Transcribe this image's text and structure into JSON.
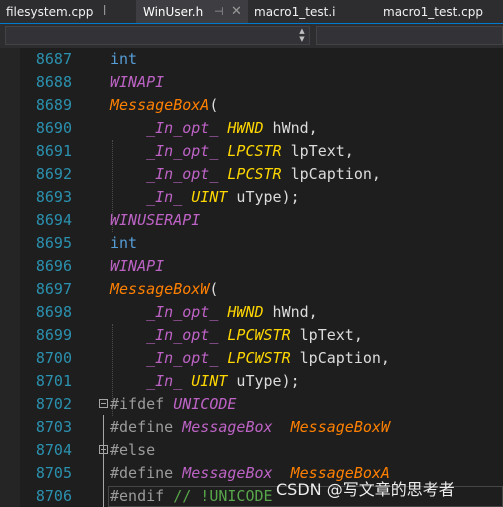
{
  "tabs": [
    {
      "label": "filesystem.cpp",
      "pin": "ꟾ"
    },
    {
      "label": "WinUser.h",
      "pin": "⊣",
      "close": "✕"
    },
    {
      "label": "macro1_test.i"
    },
    {
      "label": "macro1_test.cpp"
    }
  ],
  "nav": {
    "left_dropdown_value": "",
    "right_dropdown_value": ""
  },
  "lines": [
    {
      "n": "8687",
      "parts": [
        {
          "t": "int",
          "c": "kw"
        }
      ]
    },
    {
      "n": "8688",
      "parts": [
        {
          "t": "WINAPI",
          "c": "mac"
        }
      ]
    },
    {
      "n": "8689",
      "parts": [
        {
          "t": "MessageBoxA",
          "c": "fn"
        },
        {
          "t": "(",
          "c": ""
        }
      ]
    },
    {
      "n": "8690",
      "parts": [
        {
          "t": "    ",
          "c": ""
        },
        {
          "t": "_In_opt_",
          "c": "mac"
        },
        {
          "t": " ",
          "c": ""
        },
        {
          "t": "HWND",
          "c": "typ"
        },
        {
          "t": " hWnd,",
          "c": ""
        }
      ]
    },
    {
      "n": "8691",
      "parts": [
        {
          "t": "    ",
          "c": ""
        },
        {
          "t": "_In_opt_",
          "c": "mac"
        },
        {
          "t": " ",
          "c": ""
        },
        {
          "t": "LPCSTR",
          "c": "typ"
        },
        {
          "t": " lpText,",
          "c": ""
        }
      ]
    },
    {
      "n": "8692",
      "parts": [
        {
          "t": "    ",
          "c": ""
        },
        {
          "t": "_In_opt_",
          "c": "mac"
        },
        {
          "t": " ",
          "c": ""
        },
        {
          "t": "LPCSTR",
          "c": "typ"
        },
        {
          "t": " lpCaption,",
          "c": ""
        }
      ]
    },
    {
      "n": "8693",
      "parts": [
        {
          "t": "    ",
          "c": ""
        },
        {
          "t": "_In_",
          "c": "mac"
        },
        {
          "t": " ",
          "c": ""
        },
        {
          "t": "UINT",
          "c": "typ"
        },
        {
          "t": " uType);",
          "c": ""
        }
      ]
    },
    {
      "n": "8694",
      "parts": [
        {
          "t": "WINUSERAPI",
          "c": "mac"
        }
      ]
    },
    {
      "n": "8695",
      "parts": [
        {
          "t": "int",
          "c": "kw"
        }
      ]
    },
    {
      "n": "8696",
      "parts": [
        {
          "t": "WINAPI",
          "c": "mac"
        }
      ]
    },
    {
      "n": "8697",
      "parts": [
        {
          "t": "MessageBoxW",
          "c": "fn"
        },
        {
          "t": "(",
          "c": ""
        }
      ]
    },
    {
      "n": "8698",
      "parts": [
        {
          "t": "    ",
          "c": ""
        },
        {
          "t": "_In_opt_",
          "c": "mac"
        },
        {
          "t": " ",
          "c": ""
        },
        {
          "t": "HWND",
          "c": "typ"
        },
        {
          "t": " hWnd,",
          "c": ""
        }
      ]
    },
    {
      "n": "8699",
      "parts": [
        {
          "t": "    ",
          "c": ""
        },
        {
          "t": "_In_opt_",
          "c": "mac"
        },
        {
          "t": " ",
          "c": ""
        },
        {
          "t": "LPCWSTR",
          "c": "typ"
        },
        {
          "t": " lpText,",
          "c": ""
        }
      ]
    },
    {
      "n": "8700",
      "parts": [
        {
          "t": "    ",
          "c": ""
        },
        {
          "t": "_In_opt_",
          "c": "mac"
        },
        {
          "t": " ",
          "c": ""
        },
        {
          "t": "LPCWSTR",
          "c": "typ"
        },
        {
          "t": " lpCaption,",
          "c": ""
        }
      ]
    },
    {
      "n": "8701",
      "parts": [
        {
          "t": "    ",
          "c": ""
        },
        {
          "t": "_In_",
          "c": "mac"
        },
        {
          "t": " ",
          "c": ""
        },
        {
          "t": "UINT",
          "c": "typ"
        },
        {
          "t": " uType);",
          "c": ""
        }
      ]
    },
    {
      "n": "8702",
      "fold": true,
      "parts": [
        {
          "t": "#ifdef ",
          "c": "pp"
        },
        {
          "t": "UNICODE",
          "c": "mac"
        }
      ]
    },
    {
      "n": "8703",
      "parts": [
        {
          "t": "#define ",
          "c": "pp"
        },
        {
          "t": "MessageBox",
          "c": "mac"
        },
        {
          "t": "  ",
          "c": ""
        },
        {
          "t": "MessageBoxW",
          "c": "fn"
        }
      ]
    },
    {
      "n": "8704",
      "fold": true,
      "parts": [
        {
          "t": "#else",
          "c": "pp"
        }
      ]
    },
    {
      "n": "8705",
      "parts": [
        {
          "t": "#define ",
          "c": "pp"
        },
        {
          "t": "MessageBox",
          "c": "mac"
        },
        {
          "t": "  ",
          "c": ""
        },
        {
          "t": "MessageBoxA",
          "c": "fn"
        }
      ]
    },
    {
      "n": "8706",
      "current": true,
      "parts": [
        {
          "t": "#endif ",
          "c": "pp"
        },
        {
          "t": "// !UNICODE",
          "c": "cm"
        }
      ]
    }
  ],
  "watermark": "CSDN @写文章的思考者",
  "colors": {
    "line_number": "#2b91af",
    "keyword": "#569cd6",
    "macro": "#bd63c5",
    "function": "#ff8000",
    "type": "#ffd700",
    "comment": "#57a64a",
    "tab_underline": "#007acc"
  }
}
